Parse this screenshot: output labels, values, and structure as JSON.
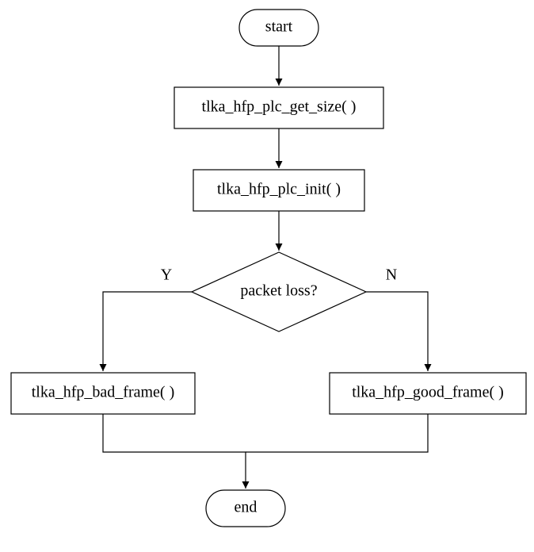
{
  "chart_data": {
    "type": "flowchart",
    "nodes": [
      {
        "id": "start",
        "kind": "terminator",
        "label": "start"
      },
      {
        "id": "getsize",
        "kind": "process",
        "label": "tlka_hfp_plc_get_size( )"
      },
      {
        "id": "init",
        "kind": "process",
        "label": "tlka_hfp_plc_init( )"
      },
      {
        "id": "decision",
        "kind": "decision",
        "label": "packet loss?"
      },
      {
        "id": "badframe",
        "kind": "process",
        "label": "tlka_hfp_bad_frame( )"
      },
      {
        "id": "goodframe",
        "kind": "process",
        "label": "tlka_hfp_good_frame( )"
      },
      {
        "id": "end",
        "kind": "terminator",
        "label": "end"
      }
    ],
    "edges": [
      {
        "from": "start",
        "to": "getsize",
        "label": ""
      },
      {
        "from": "getsize",
        "to": "init",
        "label": ""
      },
      {
        "from": "init",
        "to": "decision",
        "label": ""
      },
      {
        "from": "decision",
        "to": "badframe",
        "label": "Y"
      },
      {
        "from": "decision",
        "to": "goodframe",
        "label": "N"
      },
      {
        "from": "badframe",
        "to": "end",
        "label": ""
      },
      {
        "from": "goodframe",
        "to": "end",
        "label": ""
      }
    ]
  },
  "labels": {
    "start": "start",
    "getsize": "tlka_hfp_plc_get_size( )",
    "init": "tlka_hfp_plc_init( )",
    "decision": "packet loss?",
    "badframe": "tlka_hfp_bad_frame( )",
    "goodframe": "tlka_hfp_good_frame( )",
    "end": "end",
    "yes": "Y",
    "no": "N"
  }
}
